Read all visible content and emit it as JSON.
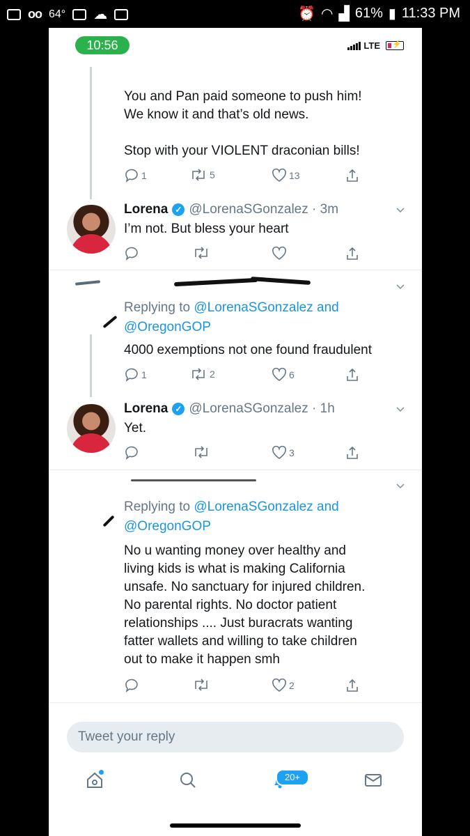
{
  "outer_status": {
    "temp": "64°",
    "battery": "61%",
    "time": "11:33 PM"
  },
  "inner_status": {
    "time": "10:56",
    "network": "LTE"
  },
  "tweets": [
    {
      "text": "You and Pan paid someone to push him!\nWe know it and that’s old news.\n\nStop with your VIOLENT draconian bills!",
      "replies": "1",
      "retweets": "5",
      "likes": "13"
    },
    {
      "name": "Lorena",
      "handle": "@LorenaSGonzalez · 3m",
      "text": "I’m not. But bless your heart",
      "replies": "",
      "retweets": "",
      "likes": ""
    },
    {
      "reply_prefix": "Replying to ",
      "reply_link1": "@LorenaSGonzalez",
      "reply_and": " and",
      "reply_link2": "@OregonGOP",
      "text": "4000 exemptions not one found fraudulent",
      "replies": "1",
      "retweets": "2",
      "likes": "6"
    },
    {
      "name": "Lorena",
      "handle": "@LorenaSGonzalez · 1h",
      "text": "Yet.",
      "replies": "",
      "retweets": "",
      "likes": "3"
    },
    {
      "reply_prefix": "Replying to ",
      "reply_link1": "@LorenaSGonzalez",
      "reply_and": " and",
      "reply_link2": "@OregonGOP",
      "text": "No u wanting money over healthy and\nliving kids is what is making California\nunsafe. No sanctuary for injured children.\nNo parental rights. No doctor patient\nrelationships .... Just buracrats wanting\nfatter wallets and willing to take children\nout to make it happen smh",
      "replies": "",
      "retweets": "",
      "likes": "2"
    }
  ],
  "reply_box": {
    "placeholder": "Tweet your reply"
  },
  "tabbar": {
    "notifications_badge": "20+"
  },
  "icons": [
    "home-icon",
    "search-icon",
    "notifications-icon",
    "messages-icon",
    "reply-icon",
    "retweet-icon",
    "like-icon",
    "share-icon",
    "chevron-down-icon",
    "verified-icon"
  ],
  "colors": {
    "link": "#1b95e0",
    "accent": "#1da1f2",
    "muted": "#657786",
    "time_pill": "#2bb24c"
  }
}
